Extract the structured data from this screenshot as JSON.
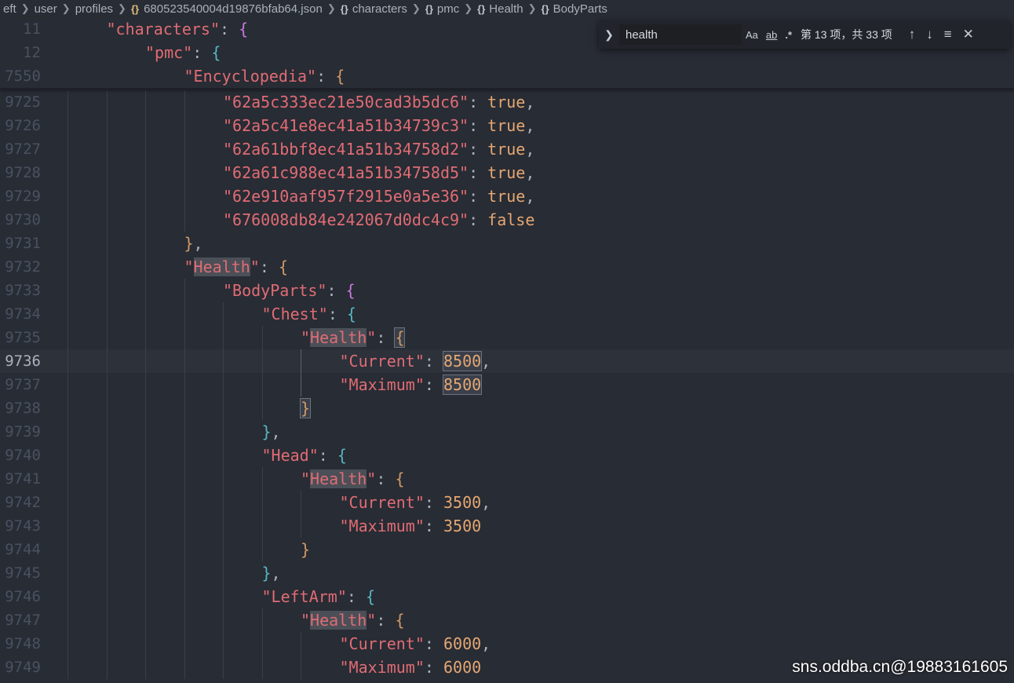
{
  "breadcrumb": [
    "eft",
    "user",
    "profiles",
    "680523540004d19876bfab64.json",
    "characters",
    "pmc",
    "Health",
    "BodyParts"
  ],
  "find": {
    "query": "health",
    "match_case_label": "Aa",
    "whole_word_label": "ab",
    "regex_label": ".*",
    "count_text": "第 13 项，共 33 项"
  },
  "editor": {
    "current_line": "9736",
    "sticky_lines": [
      {
        "num": "11",
        "key": "characters",
        "brace": "{"
      },
      {
        "num": "12",
        "key": "pmc",
        "brace": "{"
      },
      {
        "num": "7550",
        "key": "Encyclopedia",
        "brace": "{"
      }
    ],
    "lines": [
      {
        "num": "9725",
        "key": "62a5c333ec21e50cad3b5dc6",
        "value": "true",
        "end": ","
      },
      {
        "num": "9726",
        "key": "62a5c41e8ec41a51b34739c3",
        "value": "true",
        "end": ","
      },
      {
        "num": "9727",
        "key": "62a61bbf8ec41a51b34758d2",
        "value": "true",
        "end": ","
      },
      {
        "num": "9728",
        "key": "62a61c988ec41a51b34758d5",
        "value": "true",
        "end": ","
      },
      {
        "num": "9729",
        "key": "62e910aaf957f2915e0a5e36",
        "value": "true",
        "end": ","
      },
      {
        "num": "9730",
        "key": "676008db84e242067d0dc4c9",
        "value": "false",
        "end": ""
      },
      {
        "num": "9731",
        "close": "}",
        "end": ","
      },
      {
        "num": "9732",
        "key": "Health",
        "brace": "{"
      },
      {
        "num": "9733",
        "key": "BodyParts",
        "brace": "{"
      },
      {
        "num": "9734",
        "key": "Chest",
        "brace": "{"
      },
      {
        "num": "9735",
        "key": "Health",
        "brace": "{"
      },
      {
        "num": "9736",
        "key": "Current",
        "value": "8500",
        "end": ","
      },
      {
        "num": "9737",
        "key": "Maximum",
        "value": "8500",
        "end": ""
      },
      {
        "num": "9738",
        "close": "}",
        "end": ""
      },
      {
        "num": "9739",
        "close": "}",
        "end": ","
      },
      {
        "num": "9740",
        "key": "Head",
        "brace": "{"
      },
      {
        "num": "9741",
        "key": "Health",
        "brace": "{"
      },
      {
        "num": "9742",
        "key": "Current",
        "value": "3500",
        "end": ","
      },
      {
        "num": "9743",
        "key": "Maximum",
        "value": "3500",
        "end": ""
      },
      {
        "num": "9744",
        "close": "}",
        "end": ""
      },
      {
        "num": "9745",
        "close": "}",
        "end": ","
      },
      {
        "num": "9746",
        "key": "LeftArm",
        "brace": "{"
      },
      {
        "num": "9747",
        "key": "Health",
        "brace": "{"
      },
      {
        "num": "9748",
        "key": "Current",
        "value": "6000",
        "end": ","
      },
      {
        "num": "9749",
        "key": "Maximum",
        "value": "6000",
        "end": ""
      }
    ]
  },
  "watermark": "sns.oddba.cn@19883161605"
}
